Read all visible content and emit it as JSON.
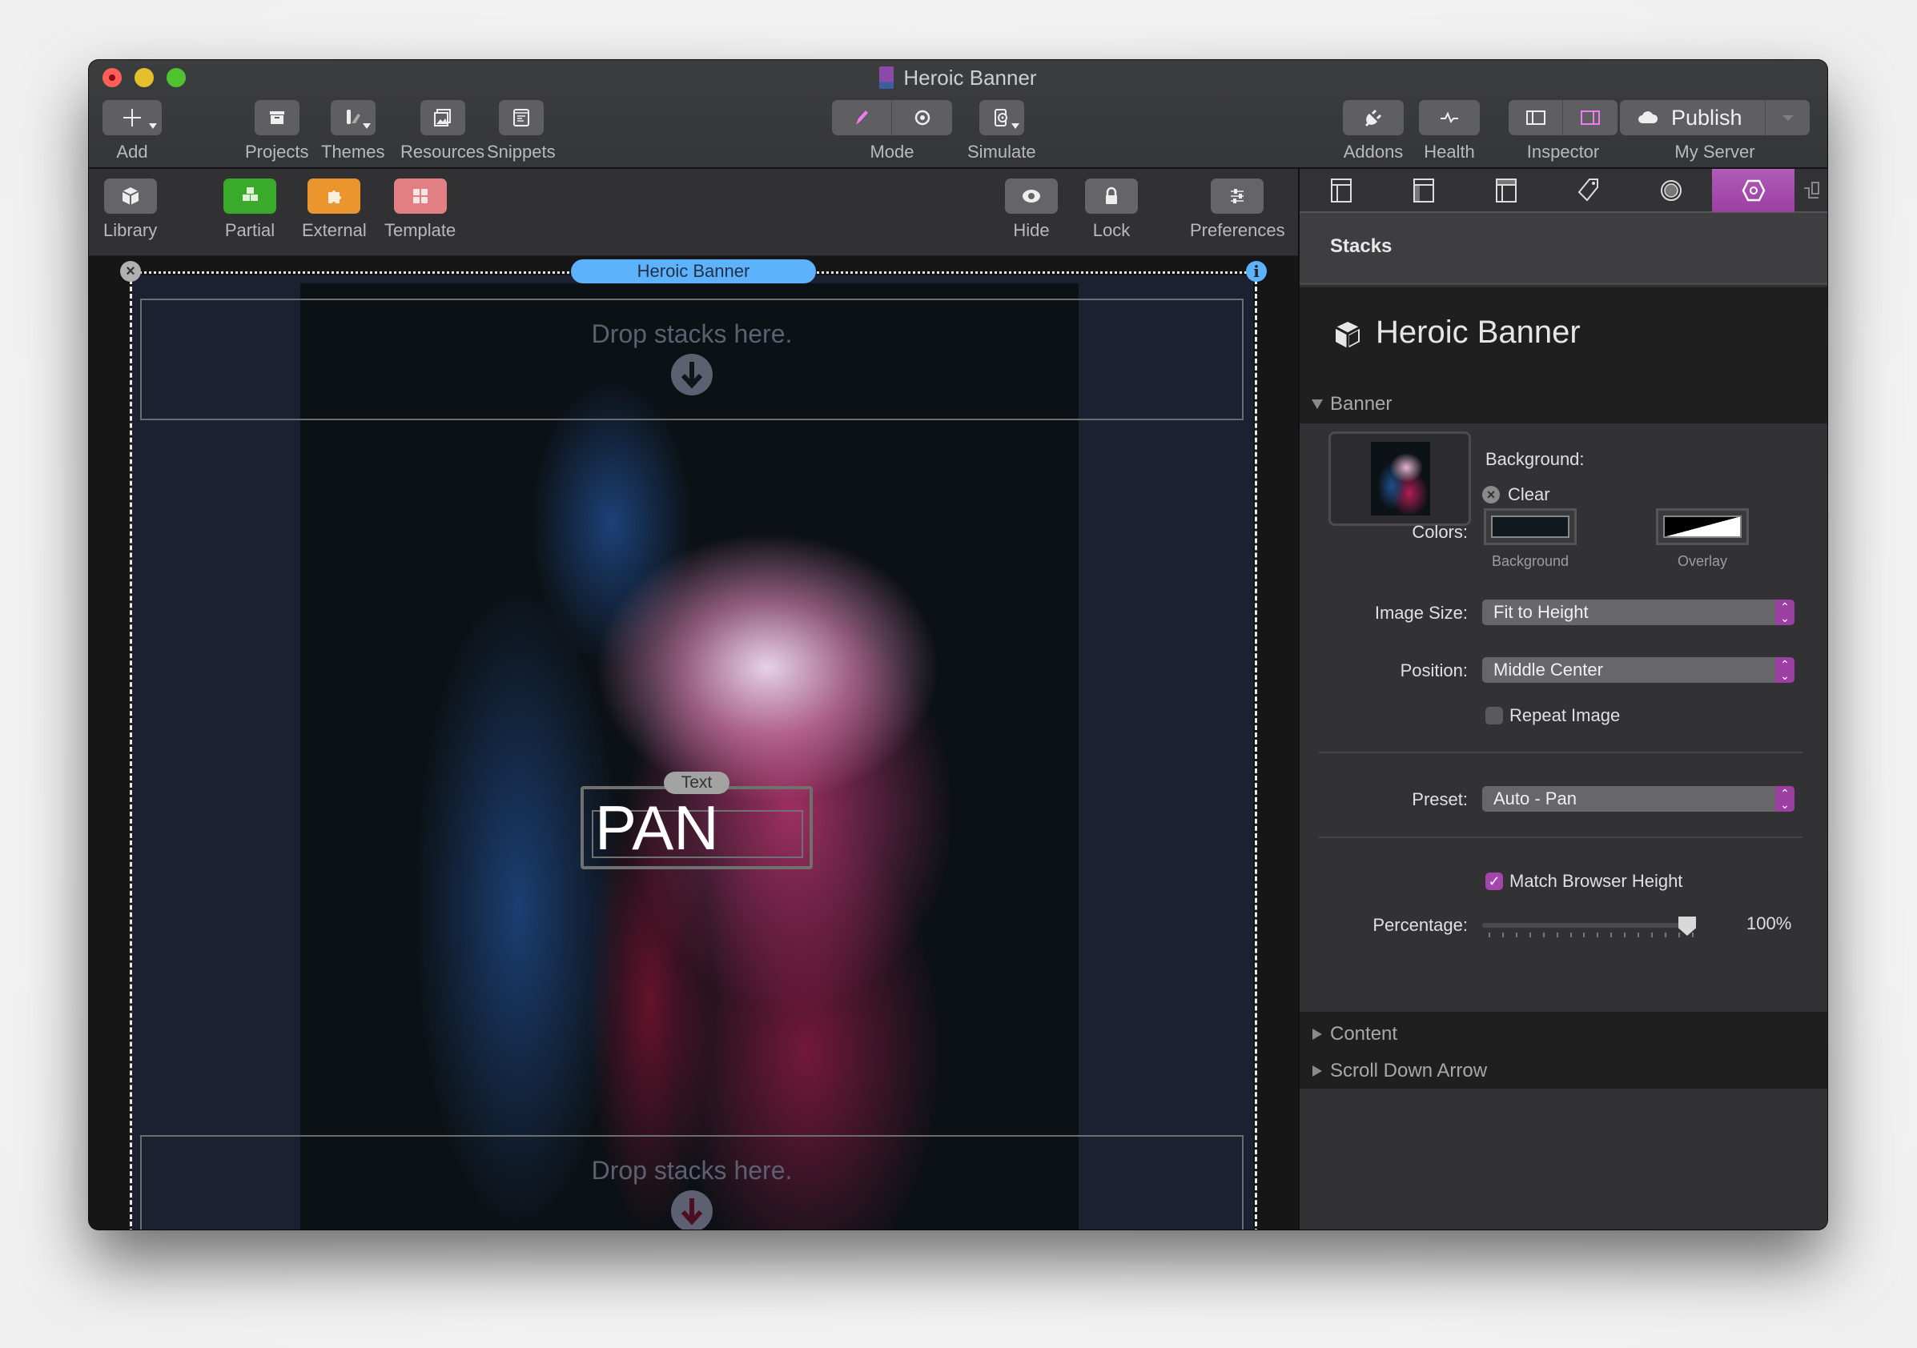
{
  "window": {
    "title": "Heroic Banner",
    "toolbar": {
      "add": "Add",
      "projects": "Projects",
      "themes": "Themes",
      "resources": "Resources",
      "snippets": "Snippets",
      "mode": "Mode",
      "simulate": "Simulate",
      "addons": "Addons",
      "health": "Health",
      "inspector": "Inspector",
      "publish": "Publish",
      "publish_target": "My Server"
    },
    "toolbar2": {
      "library": "Library",
      "partial": "Partial",
      "external": "External",
      "template": "Template",
      "hide": "Hide",
      "lock": "Lock",
      "preferences": "Preferences"
    }
  },
  "canvas": {
    "stack_label": "Heroic Banner",
    "drop_top": "Drop stacks here.",
    "drop_bottom": "Drop stacks here.",
    "text_stack_label": "Text",
    "text_content": "PAN"
  },
  "inspector": {
    "tabs": [
      "page-inspector",
      "site-inspector",
      "layout-inspector",
      "tag-inspector",
      "shape-inspector",
      "stack-inspector"
    ],
    "active_tab": "stack-inspector",
    "header": "Stacks",
    "title": "Heroic Banner",
    "sections": {
      "banner": "Banner",
      "content": "Content",
      "scroll_down_arrow": "Scroll Down Arrow"
    },
    "background_label": "Background:",
    "clear_label": "Clear",
    "colors_label": "Colors:",
    "background_color_caption": "Background",
    "background_color": "#101820",
    "overlay_caption": "Overlay",
    "image_size_label": "Image Size:",
    "image_size_value": "Fit to Height",
    "position_label": "Position:",
    "position_value": "Middle Center",
    "repeat_image_label": "Repeat Image",
    "repeat_image_checked": false,
    "preset_label": "Preset:",
    "preset_value": "Auto - Pan",
    "match_height_label": "Match Browser Height",
    "match_height_checked": true,
    "percentage_label": "Percentage:",
    "percentage_value": "100%",
    "percentage_fraction": 1.0
  },
  "colors": {
    "accent": "#a445ad",
    "selection_blue": "#5db3fb",
    "mode_edit_pink": "#f07cf0"
  }
}
